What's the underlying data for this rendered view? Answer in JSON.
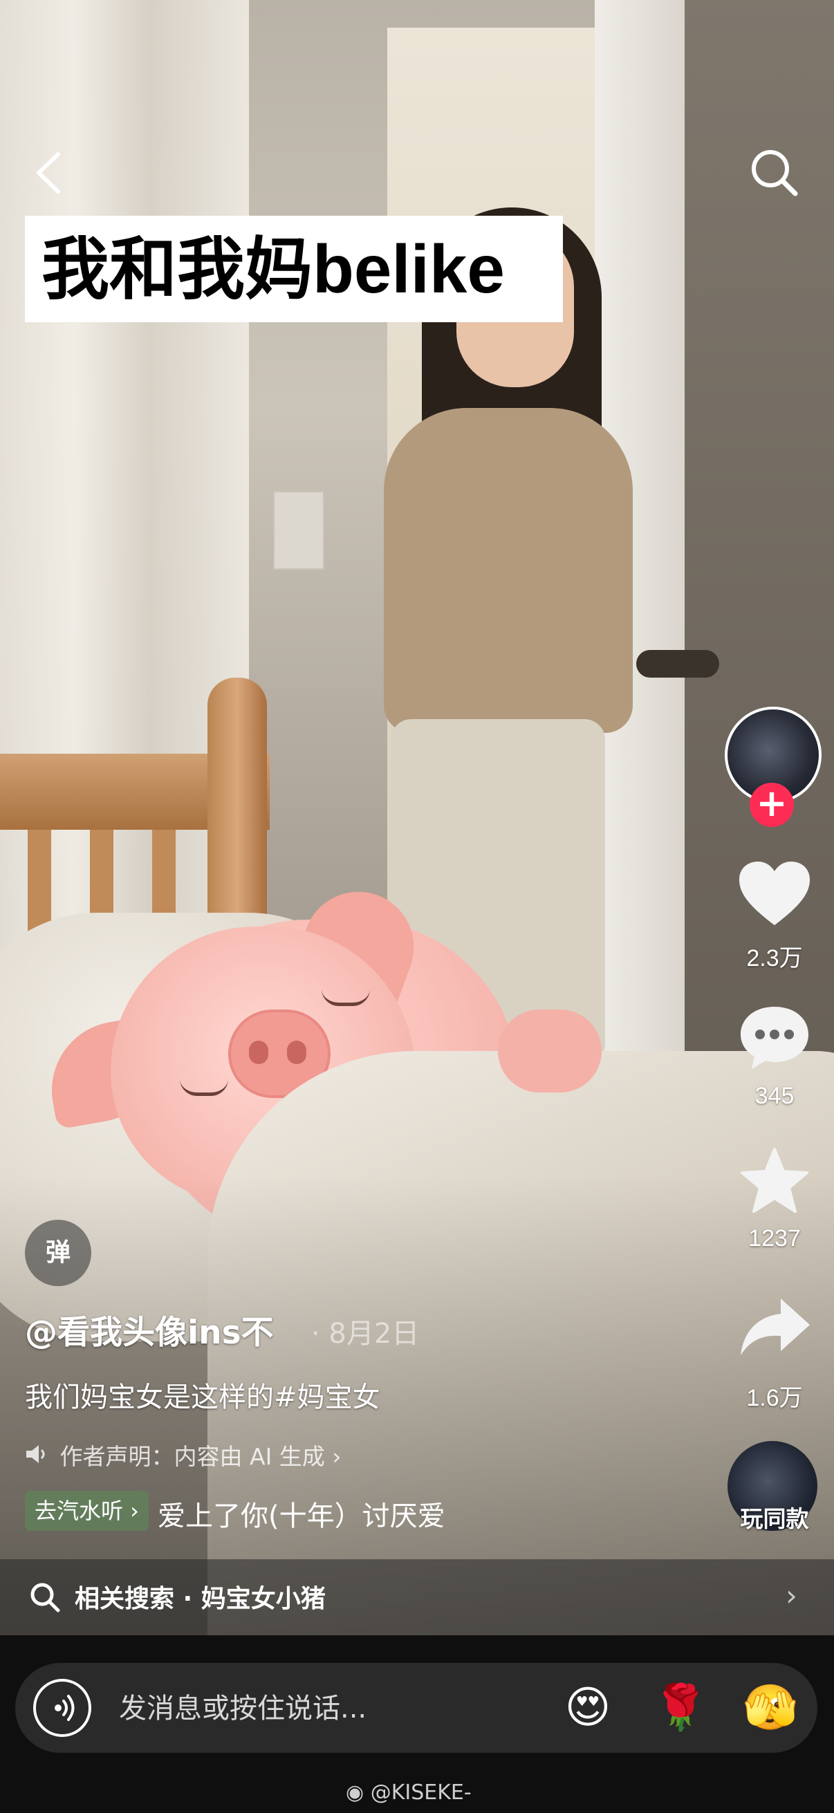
{
  "header": {
    "back_icon": "chevron-left-icon",
    "search_icon": "search-icon",
    "video_title": "我和我妈belike"
  },
  "sidebar": {
    "follow_symbol": "+",
    "like_count": "2.3万",
    "comment_count": "345",
    "favorite_count": "1237",
    "share_count": "1.6万",
    "music_label": "玩同款"
  },
  "post": {
    "danmaku_label": "弹",
    "author": "@看我头像ins不",
    "date": "· 8月2日",
    "caption": "我们妈宝女是这样的#妈宝女",
    "ai_statement": "作者声明：内容由 AI 生成 ›",
    "music_tag": "去汽水听 ›",
    "song": "爱上了你(十年）讨厌爱"
  },
  "related_search": {
    "label": "相关搜索 · 妈宝女小猪",
    "chevron": "›"
  },
  "bottom_bar": {
    "placeholder": "发消息或按住说话...",
    "emoji_1": "😍",
    "emoji_2": "🌹",
    "emoji_3": "🫣",
    "watermark": "@KISEKE-"
  },
  "colors": {
    "accent": "#fe2c55",
    "bottom_bg": "#0f0f0f",
    "music_tag_bg": "#60825a"
  }
}
